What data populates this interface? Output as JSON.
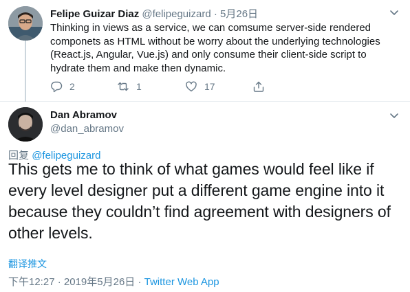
{
  "parent_tweet": {
    "display_name": "Felipe Guizar Diaz",
    "handle": "@felipeguizard",
    "separator": "·",
    "date": "5月26日",
    "text": "Thinking in views as a service, we can comsume server-side rendered componets as HTML without be worry about the underlying technologies (React.js, Angular, Vue.js) and only consume their client-side script to hydrate them and make then dynamic.",
    "reply_icon": "reply-icon",
    "retweet_icon": "retweet-icon",
    "like_icon": "heart-icon",
    "share_icon": "share-icon",
    "reply_count": "2",
    "retweet_count": "1",
    "like_count": "17"
  },
  "main_tweet": {
    "display_name": "Dan Abramov",
    "handle": "@dan_abramov",
    "reply_prefix": "回复",
    "reply_target": "@felipeguizard",
    "text": "This gets me to think of what games would feel like if every level designer put a different game engine into it because they couldn’t find agreement with designers of other levels.",
    "translate_label": "翻译推文",
    "time": "下午12:27",
    "separator": "·",
    "date": "2019年5月26日",
    "source": "Twitter Web App"
  },
  "colors": {
    "link": "#1b95e0",
    "muted": "#657786",
    "text": "#14171a",
    "divider": "#e6ecf0"
  }
}
